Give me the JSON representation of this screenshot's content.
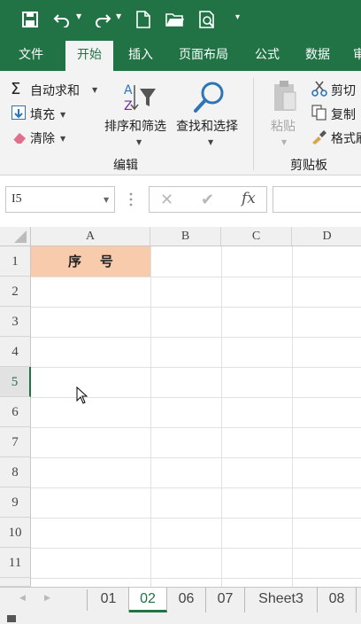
{
  "quick_access": {
    "icons": [
      "save-icon",
      "undo-icon",
      "redo-icon",
      "new-file-icon",
      "open-folder-icon",
      "print-preview-icon",
      "customize-caret-icon"
    ]
  },
  "tabs": [
    {
      "label": "文件",
      "active": false
    },
    {
      "label": "开始",
      "active": true
    },
    {
      "label": "插入",
      "active": false
    },
    {
      "label": "页面布局",
      "active": false
    },
    {
      "label": "公式",
      "active": false
    },
    {
      "label": "数据",
      "active": false
    },
    {
      "label": "审",
      "active": false
    }
  ],
  "ribbon": {
    "editing": {
      "autosum_label": "自动求和",
      "fill_label": "填充",
      "clear_label": "清除",
      "sort_filter_label": "排序和筛选",
      "find_select_label": "查找和选择",
      "group_label": "编辑"
    },
    "clipboard": {
      "paste_label": "粘贴",
      "cut_label": "剪切",
      "copy_label": "复制",
      "format_painter_label": "格式刷",
      "group_label": "剪贴板"
    }
  },
  "formula_bar": {
    "name_box": "I5",
    "fx_label": "fx",
    "formula": ""
  },
  "grid": {
    "columns": [
      "A",
      "B",
      "C",
      "D"
    ],
    "rows": [
      "1",
      "2",
      "3",
      "4",
      "5",
      "6",
      "7",
      "8",
      "9",
      "10",
      "11"
    ],
    "active_row": "5",
    "cells": {
      "A1": "序    号"
    },
    "header_fill": "#f8cbad"
  },
  "sheets": [
    {
      "label": "01",
      "active": false
    },
    {
      "label": "02",
      "active": true
    },
    {
      "label": "06",
      "active": false
    },
    {
      "label": "07",
      "active": false
    },
    {
      "label": "Sheet3",
      "active": false
    },
    {
      "label": "08",
      "active": false
    }
  ],
  "colors": {
    "brand": "#217346",
    "ribbon_bg": "#f3f3f3"
  }
}
